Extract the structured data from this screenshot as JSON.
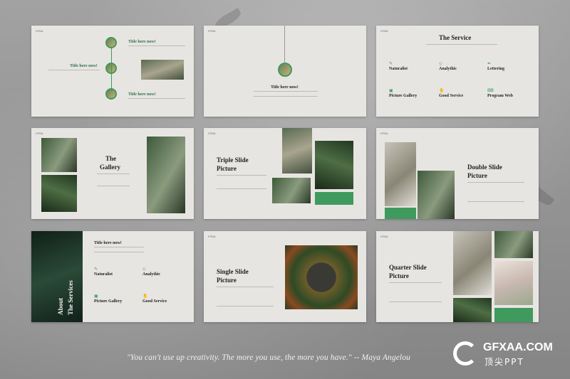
{
  "logo": "HTML",
  "slides": {
    "s1": {
      "t1": "Title here now!",
      "t2": "Title here now!",
      "t3": "Title here now!"
    },
    "s2": {
      "t1": "Title here now!"
    },
    "s3": {
      "title": "The Service",
      "items": [
        "Naturalist",
        "Analythic",
        "Lettering",
        "Picture Gallery",
        "Good Service",
        "Program Web"
      ]
    },
    "s4": {
      "title_line1": "The",
      "title_line2": "Gallery"
    },
    "s5": {
      "title_line1": "Triple Slide",
      "title_line2": "Picture"
    },
    "s6": {
      "title_line1": "Double Slide",
      "title_line2": "Picture"
    },
    "s7": {
      "side_line1": "About",
      "side_line2": "The Services",
      "heading": "Title here now!",
      "items": [
        "Naturalist",
        "Analythic",
        "Picture Gallery",
        "Good Service"
      ]
    },
    "s8": {
      "title_line1": "Single Slide",
      "title_line2": "Picture"
    },
    "s9": {
      "title_line1": "Quarter Slide",
      "title_line2": "Picture"
    }
  },
  "quote": "\"You can't use up creativity. The more you use, the more you have.\" -- Maya Angelou",
  "watermark": {
    "main": "GFXAA.COM",
    "sub": "顶尖PPT"
  }
}
